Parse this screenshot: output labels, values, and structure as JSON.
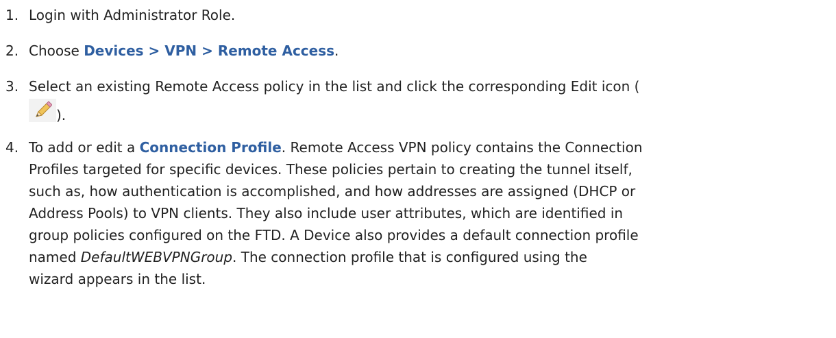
{
  "steps": [
    {
      "number": "1.",
      "text": "Login with Administrator Role."
    },
    {
      "number": "2.",
      "prefix": "Choose ",
      "link": "Devices > VPN > Remote Access",
      "suffix": "."
    },
    {
      "number": "3.",
      "text": "Select an existing Remote Access policy in the list and click the corresponding Edit icon (",
      "icon": "edit-pencil-icon",
      "suffix": ")."
    },
    {
      "number": "4.",
      "prefix": "To add or edit a ",
      "link": "Connection Profile",
      "line1_rest": ". Remote Access VPN policy contains the Connection",
      "line2": "Profiles targeted for specific devices. These policies pertain to creating the tunnel itself,",
      "line3": "such as, how authentication is accomplished, and how addresses are assigned (DHCP or",
      "line4": "Address Pools) to VPN clients. They also include user attributes, which are identified in",
      "line5": "group policies configured on the FTD. A Device also provides a default connection profile",
      "line6_prefix": "named ",
      "default_group": "DefaultWEBVPNGroup",
      "line6_rest": ". The connection profile that is configured using the",
      "line7": "wizard appears in the list."
    }
  ],
  "colors": {
    "text": "#222222",
    "link": "#2f5fa1",
    "icon_background": "#f2f2f2"
  }
}
